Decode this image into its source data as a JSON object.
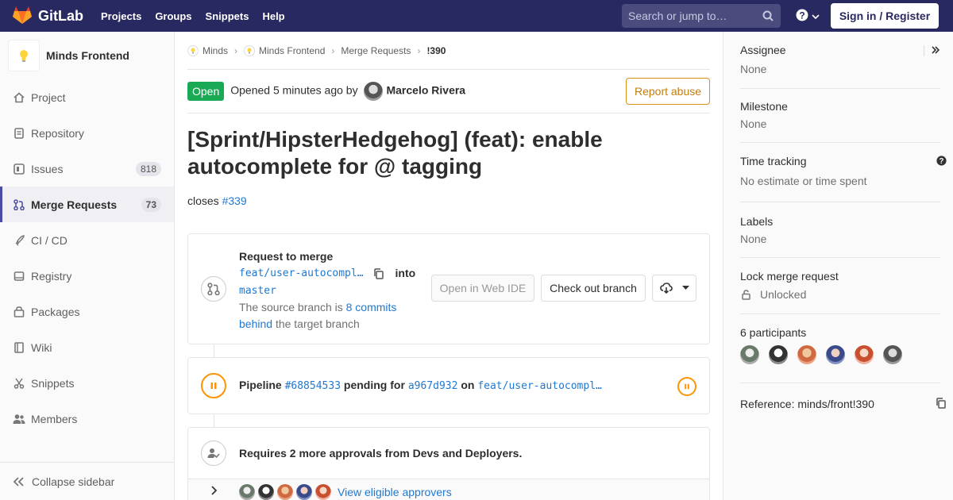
{
  "navbar": {
    "brand": "GitLab",
    "links": [
      "Projects",
      "Groups",
      "Snippets",
      "Help"
    ],
    "search_placeholder": "Search or jump to…",
    "signin": "Sign in / Register"
  },
  "sidebar": {
    "project_name": "Minds Frontend",
    "items": [
      {
        "label": "Project",
        "icon": "home-icon"
      },
      {
        "label": "Repository",
        "icon": "doc-icon"
      },
      {
        "label": "Issues",
        "icon": "issues-icon",
        "badge": "818"
      },
      {
        "label": "Merge Requests",
        "icon": "merge-request-icon",
        "badge": "73",
        "active": true
      },
      {
        "label": "CI / CD",
        "icon": "rocket-icon"
      },
      {
        "label": "Registry",
        "icon": "disk-icon"
      },
      {
        "label": "Packages",
        "icon": "package-icon"
      },
      {
        "label": "Wiki",
        "icon": "book-icon"
      },
      {
        "label": "Snippets",
        "icon": "scissors-icon"
      },
      {
        "label": "Members",
        "icon": "users-icon"
      }
    ],
    "collapse_label": "Collapse sidebar"
  },
  "breadcrumb": [
    "Minds",
    "Minds Frontend",
    "Merge Requests",
    "!390"
  ],
  "mr": {
    "status": "Open",
    "opened_prefix": "Opened 5 minutes ago by",
    "author": "Marcelo Rivera",
    "report_abuse": "Report abuse",
    "title": "[Sprint/HipsterHedgehog] (feat): enable autocomplete for @ tagging",
    "description_prefix": "closes",
    "description_link": "#339"
  },
  "merge_widget": {
    "title": "Request to merge",
    "source_branch": "feat/user-autocompl…",
    "into_label": "into",
    "target_branch": "master",
    "behind_prefix": "The source branch is",
    "behind_link": "8 commits behind",
    "behind_suffix": "the target branch",
    "web_ide": "Open in Web IDE",
    "checkout": "Check out branch"
  },
  "pipeline": {
    "label": "Pipeline",
    "id": "#68854533",
    "status_text": "pending for",
    "commit": "a967d932",
    "on_label": "on",
    "branch": "feat/user-autocompl…"
  },
  "approvals": {
    "text": "Requires 2 more approvals from Devs and Deployers.",
    "link": "View eligible approvers"
  },
  "right_sidebar": {
    "assignee_title": "Assignee",
    "assignee_value": "None",
    "milestone_title": "Milestone",
    "milestone_value": "None",
    "time_title": "Time tracking",
    "time_value": "No estimate or time spent",
    "labels_title": "Labels",
    "labels_value": "None",
    "lock_title": "Lock merge request",
    "lock_value": "Unlocked",
    "participants_title": "6 participants",
    "reference": "Reference: minds/front!390"
  },
  "colors": {
    "navbar": "#292961",
    "status_open": "#1aaa55",
    "link": "#1f78d1",
    "pending": "#fc9403",
    "report": "#db8f1a"
  }
}
